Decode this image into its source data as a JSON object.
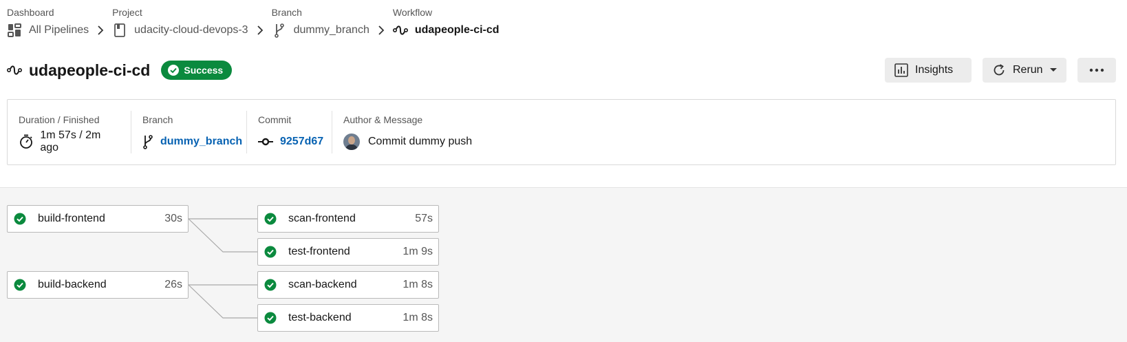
{
  "breadcrumb": [
    {
      "label": "Dashboard",
      "value": "All Pipelines",
      "icon": "dashboard-icon"
    },
    {
      "label": "Project",
      "value": "udacity-cloud-devops-3",
      "icon": "project-icon"
    },
    {
      "label": "Branch",
      "value": "dummy_branch",
      "icon": "branch-icon"
    },
    {
      "label": "Workflow",
      "value": "udapeople-ci-cd",
      "icon": "workflow-icon"
    }
  ],
  "header": {
    "title": "udapeople-ci-cd",
    "status": "Success",
    "status_color": "#0b8a3e",
    "insights_label": "Insights",
    "rerun_label": "Rerun",
    "more_label": "•••"
  },
  "info": {
    "duration_label": "Duration / Finished",
    "duration_value": "1m 57s / 2m ago",
    "branch_label": "Branch",
    "branch_value": "dummy_branch",
    "commit_label": "Commit",
    "commit_value": "9257d67",
    "author_label": "Author & Message",
    "author_message": "Commit dummy push",
    "link_color": "#0762b2"
  },
  "jobs": [
    {
      "name": "build-frontend",
      "time": "30s",
      "status": "success"
    },
    {
      "name": "scan-frontend",
      "time": "57s",
      "status": "success"
    },
    {
      "name": "test-frontend",
      "time": "1m 9s",
      "status": "success"
    },
    {
      "name": "build-backend",
      "time": "26s",
      "status": "success"
    },
    {
      "name": "scan-backend",
      "time": "1m 8s",
      "status": "success"
    },
    {
      "name": "test-backend",
      "time": "1m 8s",
      "status": "success"
    }
  ]
}
